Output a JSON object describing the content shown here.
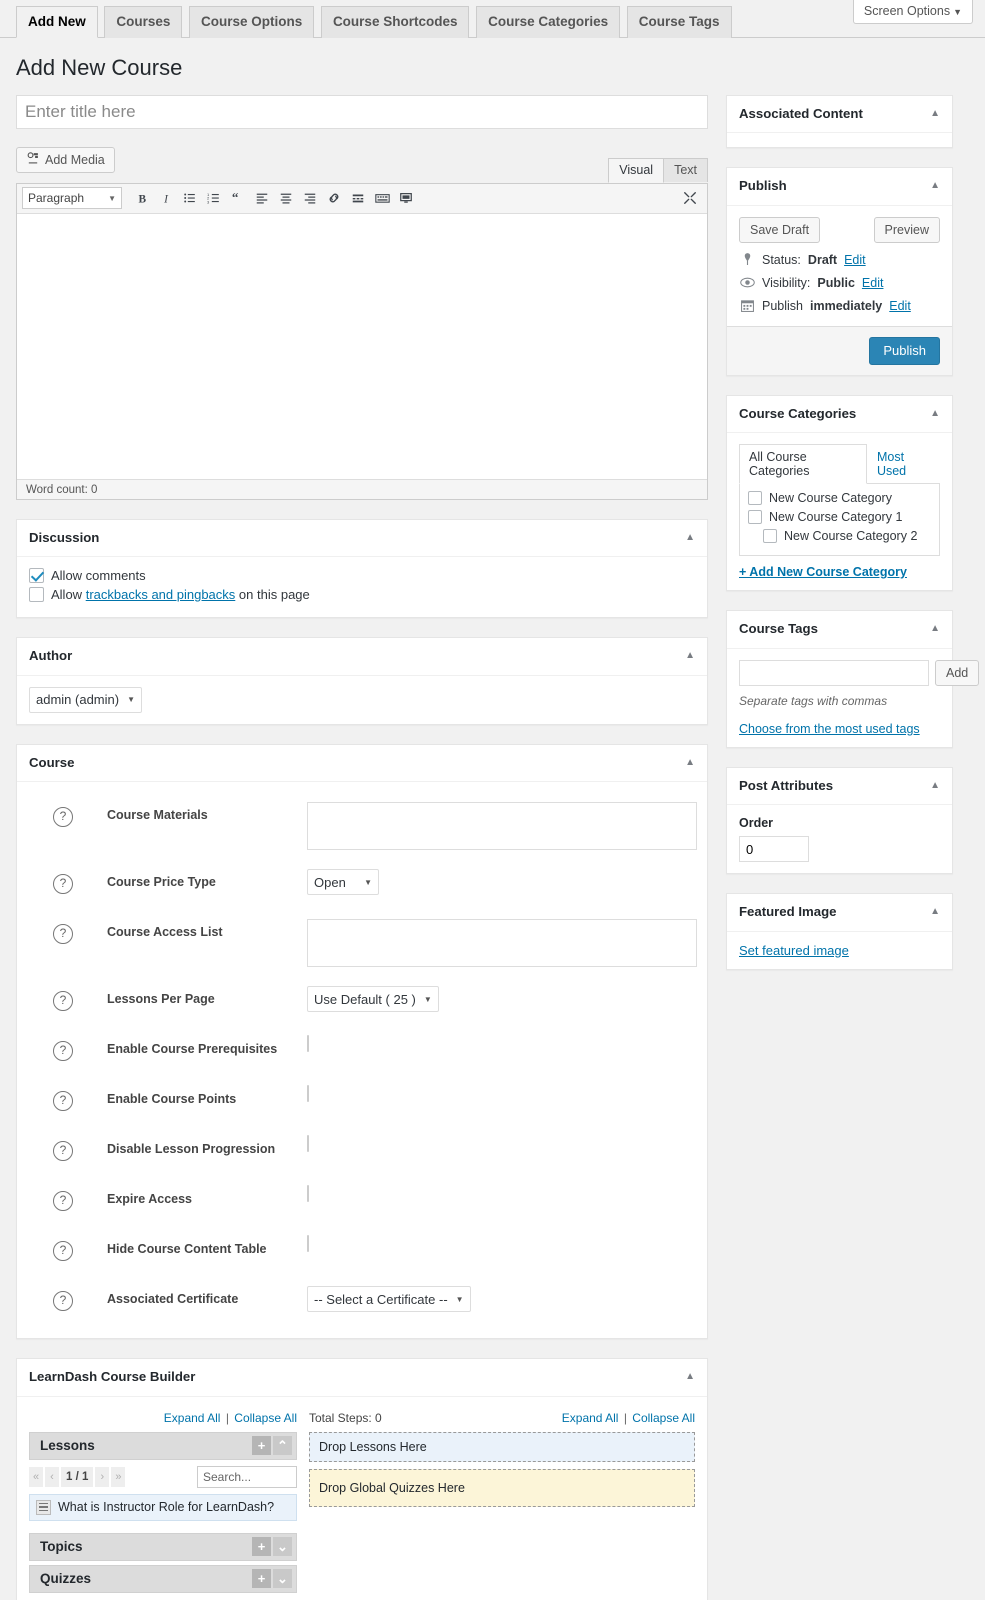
{
  "header": {
    "tabs": [
      {
        "label": "Add New",
        "active": true
      },
      {
        "label": "Courses",
        "active": false
      },
      {
        "label": "Course Options",
        "active": false
      },
      {
        "label": "Course Shortcodes",
        "active": false
      },
      {
        "label": "Course Categories",
        "active": false
      },
      {
        "label": "Course Tags",
        "active": false
      }
    ],
    "screen_options": "Screen Options",
    "page_title": "Add New Course"
  },
  "title_field": {
    "placeholder": "Enter title here",
    "value": ""
  },
  "editor": {
    "add_media": "Add Media",
    "tab_visual": "Visual",
    "tab_text": "Text",
    "format": "Paragraph",
    "word_count": "Word count: 0",
    "content": "",
    "toolbar_icons": [
      "bold-icon",
      "italic-icon",
      "bulleted-list-icon",
      "numbered-list-icon",
      "blockquote-icon",
      "align-left-icon",
      "align-center-icon",
      "align-right-icon",
      "link-icon",
      "read-more-icon",
      "toolbar-toggle-icon",
      "distraction-free-icon"
    ],
    "fullscreen_icon": "fullscreen-icon"
  },
  "discussion": {
    "title": "Discussion",
    "allow_comments": "Allow comments",
    "allow_comments_checked": true,
    "pingbacks_prefix": "Allow",
    "pingbacks_link": "trackbacks and pingbacks",
    "pingbacks_suffix": "on this page",
    "pingbacks_checked": false
  },
  "author": {
    "title": "Author",
    "selected": "admin (admin)"
  },
  "course": {
    "title": "Course",
    "fields": [
      {
        "label": "Course Materials",
        "type": "textarea",
        "value": ""
      },
      {
        "label": "Course Price Type",
        "type": "select",
        "value": "Open"
      },
      {
        "label": "Course Access List",
        "type": "textarea",
        "value": ""
      },
      {
        "label": "Lessons Per Page",
        "type": "select",
        "value": "Use Default ( 25 )"
      },
      {
        "label": "Enable Course Prerequisites",
        "type": "checkbox",
        "checked": false
      },
      {
        "label": "Enable Course Points",
        "type": "checkbox",
        "checked": false
      },
      {
        "label": "Disable Lesson Progression",
        "type": "checkbox",
        "checked": false
      },
      {
        "label": "Expire Access",
        "type": "checkbox",
        "checked": false
      },
      {
        "label": "Hide Course Content Table",
        "type": "checkbox",
        "checked": false
      },
      {
        "label": "Associated Certificate",
        "type": "select",
        "value": "-- Select a Certificate --"
      }
    ],
    "help_icon": "?"
  },
  "builder": {
    "title": "LearnDash Course Builder",
    "left_expand": "Expand All",
    "left_collapse": "Collapse All",
    "right_expand": "Expand All",
    "right_collapse": "Collapse All",
    "separator": "|",
    "total_steps": "Total Steps: 0",
    "sections": [
      {
        "name": "Lessons",
        "add_icon": "plus-icon",
        "toggle_icon": "chevron-up-icon"
      },
      {
        "name": "Topics",
        "add_icon": "plus-icon",
        "toggle_icon": "chevron-down-icon"
      },
      {
        "name": "Quizzes",
        "add_icon": "plus-icon",
        "toggle_icon": "chevron-down-icon"
      }
    ],
    "pager": {
      "first": "«",
      "prev": "‹",
      "page": "1 / 1",
      "next": "›",
      "last": "»"
    },
    "search_placeholder": "Search...",
    "lesson_item": "What is Instructor Role for LearnDash?",
    "drop_lessons": "Drop Lessons Here",
    "drop_quizzes": "Drop Global Quizzes Here"
  },
  "sidebar": {
    "associated_content": {
      "title": "Associated Content"
    },
    "publish": {
      "title": "Publish",
      "save_draft": "Save Draft",
      "preview": "Preview",
      "status_label": "Status:",
      "status_value": "Draft",
      "status_edit": "Edit",
      "visibility_label": "Visibility:",
      "visibility_value": "Public",
      "visibility_edit": "Edit",
      "publish_label": "Publish",
      "publish_value": "immediately",
      "publish_edit": "Edit",
      "publish_button": "Publish",
      "accent": "#2b85b5"
    },
    "categories": {
      "title": "Course Categories",
      "tab_all": "All Course Categories",
      "tab_most_used": "Most Used",
      "items": [
        {
          "label": "New Course Category",
          "checked": false,
          "indent": false
        },
        {
          "label": "New Course Category 1",
          "checked": false,
          "indent": false
        },
        {
          "label": "New Course Category 2",
          "checked": false,
          "indent": true
        }
      ],
      "add_new": "+ Add New Course Category"
    },
    "tags": {
      "title": "Course Tags",
      "input_value": "",
      "add_button": "Add",
      "hint": "Separate tags with commas",
      "most_used_link": "Choose from the most used tags"
    },
    "post_attributes": {
      "title": "Post Attributes",
      "order_label": "Order",
      "order_value": "0"
    },
    "featured_image": {
      "title": "Featured Image",
      "set_link": "Set featured image"
    }
  }
}
